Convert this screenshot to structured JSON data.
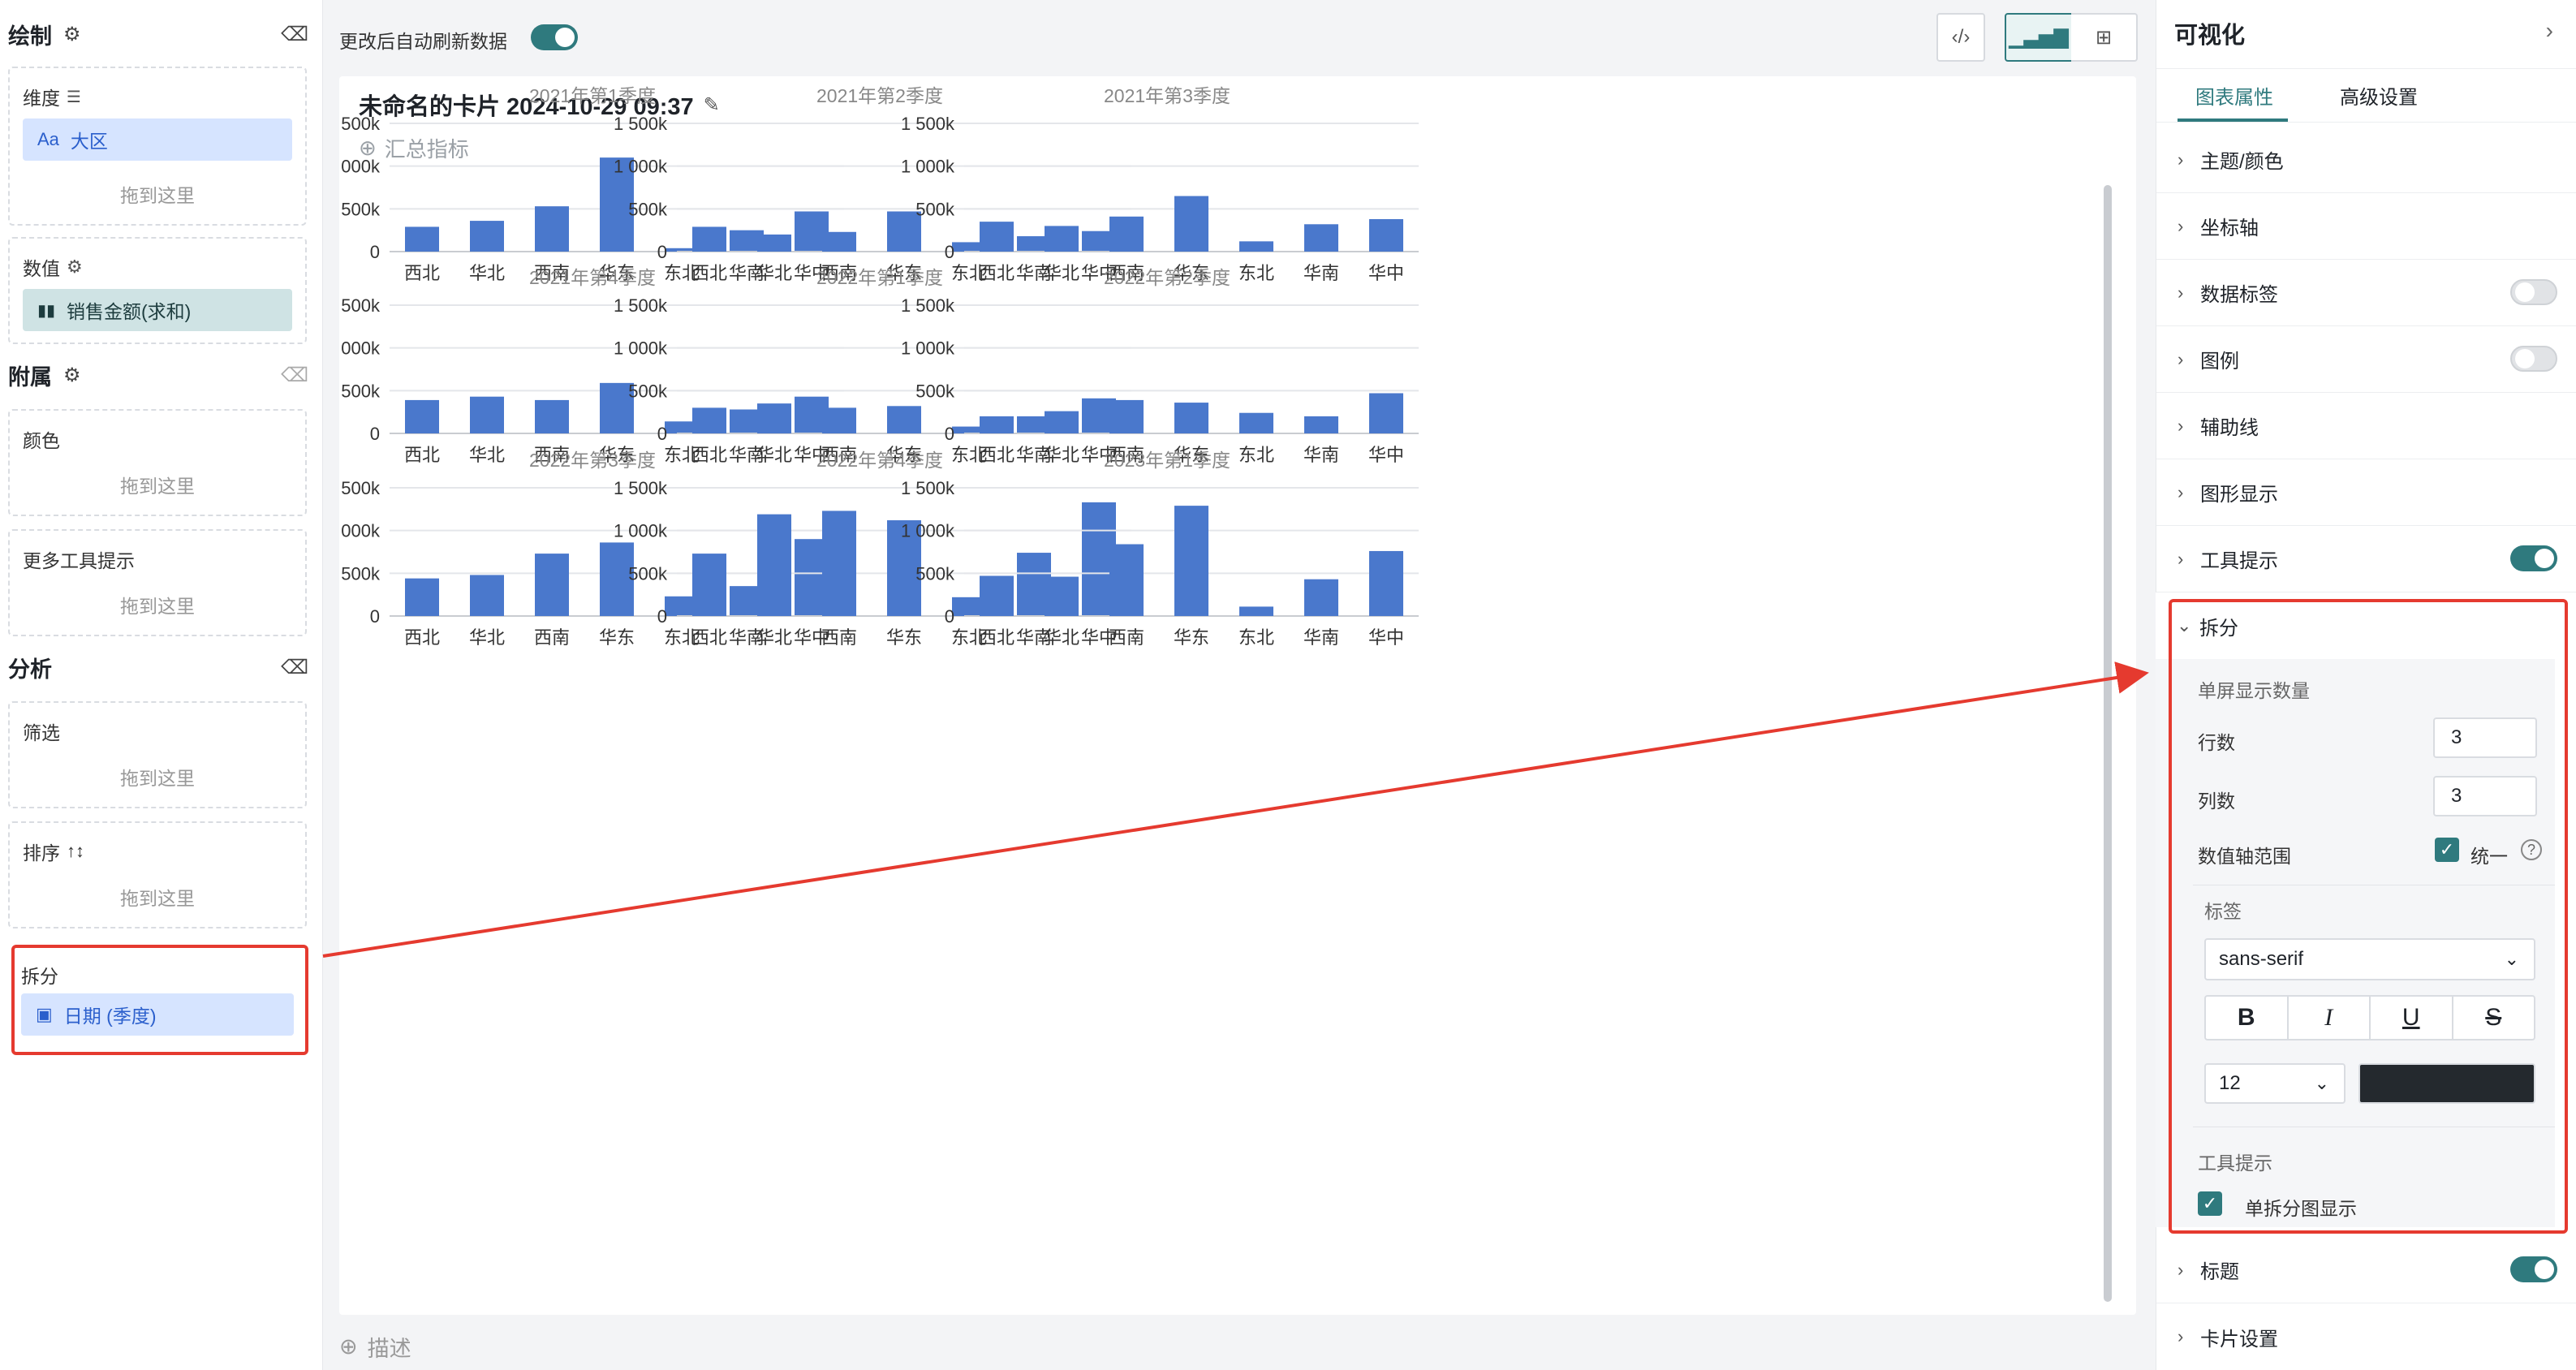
{
  "left": {
    "draw": {
      "title": "绘制",
      "dimension_label": "维度",
      "dimension_field": "大区",
      "dimension_type": "Aa",
      "dimension_hint": "拖到这里",
      "value_label": "数值",
      "value_field": "销售金额(求和)"
    },
    "attach": {
      "title": "附属",
      "color_label": "颜色",
      "color_hint": "拖到这里",
      "tooltip_label": "更多工具提示",
      "tooltip_hint": "拖到这里"
    },
    "analysis": {
      "title": "分析",
      "filter_label": "筛选",
      "filter_hint": "拖到这里",
      "sort_label": "排序",
      "sort_hint": "拖到这里",
      "split_label": "拆分",
      "split_field": "日期 (季度)"
    }
  },
  "topbar": {
    "auto_refresh_label": "更改后自动刷新数据",
    "auto_refresh_on": true
  },
  "card": {
    "title": "未命名的卡片 2024-10-29 09:37",
    "summary_label": "汇总指标",
    "describe_label": "描述"
  },
  "right": {
    "title": "可视化",
    "tabs": [
      "图表属性",
      "高级设置"
    ],
    "active_tab": 0,
    "rows_top": [
      {
        "label": "主题/颜色",
        "toggle": null
      },
      {
        "label": "坐标轴",
        "toggle": null
      },
      {
        "label": "数据标签",
        "toggle": false
      },
      {
        "label": "图例",
        "toggle": false
      },
      {
        "label": "辅助线",
        "toggle": null
      },
      {
        "label": "图形显示",
        "toggle": null
      },
      {
        "label": "工具提示",
        "toggle": true
      }
    ],
    "split": {
      "label": "拆分",
      "per_screen_label": "单屏显示数量",
      "rows_label": "行数",
      "rows_value": "3",
      "cols_label": "列数",
      "cols_value": "3",
      "axis_range_label": "数值轴范围",
      "unify_label": "统一",
      "tag_label": "标签",
      "font": "sans-serif",
      "font_size": "12",
      "font_color": "#24292e",
      "format_buttons": [
        "B",
        "I",
        "U",
        "S"
      ],
      "tooltip_label": "工具提示",
      "single_split_label": "单拆分图显示"
    },
    "rows_bottom": [
      {
        "label": "标题",
        "toggle": true
      },
      {
        "label": "卡片设置",
        "toggle": null
      }
    ]
  },
  "colors": {
    "accent": "#2f7a7e",
    "bar": "#4a78cc",
    "highlight": "#e53a2f"
  },
  "chart_data": {
    "type": "bar",
    "layout": "small-multiples 3x3",
    "categories": [
      "西北",
      "华北",
      "西南",
      "华东",
      "东北",
      "华南",
      "华中"
    ],
    "y_ticks": [
      "0",
      "500k",
      "1 000k",
      "1 500k"
    ],
    "ylim": [
      0,
      1500000
    ],
    "grid": true,
    "panels": [
      {
        "title": "2021年第1季度",
        "values": [
          290000,
          360000,
          530000,
          1100000,
          40000,
          250000,
          470000
        ]
      },
      {
        "title": "2021年第2季度",
        "values": [
          290000,
          200000,
          230000,
          470000,
          110000,
          180000,
          240000
        ]
      },
      {
        "title": "2021年第3季度",
        "values": [
          350000,
          300000,
          410000,
          650000,
          120000,
          320000,
          380000
        ]
      },
      {
        "title": "2021年第4季度",
        "values": [
          390000,
          430000,
          390000,
          590000,
          140000,
          280000,
          430000
        ]
      },
      {
        "title": "2022年第1季度",
        "values": [
          300000,
          350000,
          300000,
          320000,
          80000,
          200000,
          410000
        ]
      },
      {
        "title": "2022年第2季度",
        "values": [
          200000,
          260000,
          390000,
          360000,
          240000,
          200000,
          470000
        ]
      },
      {
        "title": "2022年第3季度",
        "values": [
          440000,
          480000,
          730000,
          860000,
          230000,
          350000,
          900000
        ]
      },
      {
        "title": "2022年第4季度",
        "values": [
          730000,
          1190000,
          1230000,
          1120000,
          220000,
          740000,
          1330000
        ]
      },
      {
        "title": "2023年第1季度",
        "values": [
          470000,
          460000,
          840000,
          1290000,
          110000,
          430000,
          760000
        ]
      }
    ]
  }
}
